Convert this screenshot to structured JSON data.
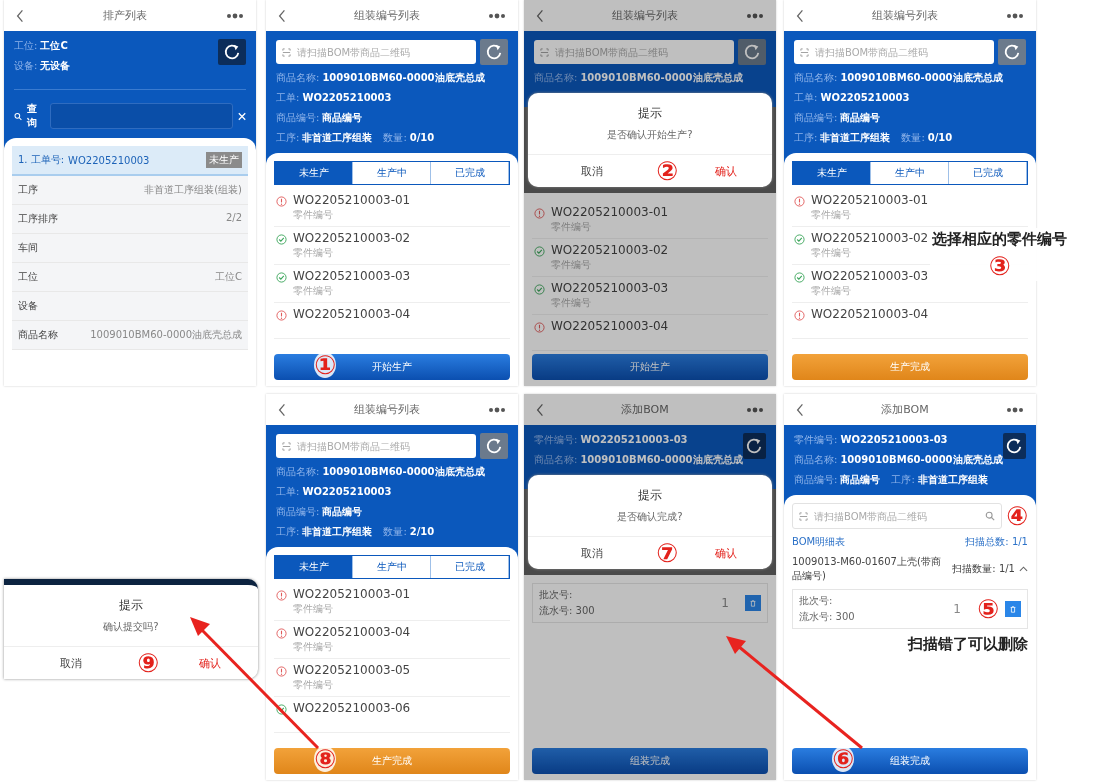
{
  "panels": [
    {
      "kind": "schedule",
      "title": "排产列表",
      "fields": [
        {
          "label": "工位:",
          "value": "工位C"
        },
        {
          "label": "设备:",
          "value": "无设备"
        }
      ],
      "search_label": "查询",
      "order": {
        "label": "1. 工单号:",
        "value": "WO2205210003",
        "badge": "未生产"
      },
      "rows": [
        {
          "label": "工序",
          "value": "非首道工序组装(组装)"
        },
        {
          "label": "工序排序",
          "value": "2/2"
        },
        {
          "label": "车间"
        },
        {
          "label": "工位",
          "value": "工位C"
        },
        {
          "label": "设备"
        },
        {
          "label": "商品名称",
          "value": "1009010BM60-0000油底壳总成"
        }
      ]
    },
    {
      "kind": "parts",
      "dimmed": false,
      "title": "组装编号列表",
      "placeholder": "请扫描BOM带商品二维码",
      "info": [
        {
          "label": "商品名称:",
          "value": "1009010BM60-0000油底壳总成"
        },
        {
          "label": "工单:",
          "value": "WO2205210003"
        },
        {
          "label": "商品编号:",
          "value": "商品编号"
        },
        {
          "label": "工序:",
          "value": "非首道工序组装",
          "label2": "数量:",
          "value2": "0/10"
        }
      ],
      "tabs": [
        {
          "label": "未生产",
          "selected": true
        },
        {
          "label": "生产中",
          "selected": false
        },
        {
          "label": "已完成",
          "selected": false
        }
      ],
      "items": [
        {
          "code": "WO2205210003-01",
          "sub": "零件编号",
          "done": false
        },
        {
          "code": "WO2205210003-02",
          "sub": "零件编号",
          "done": true
        },
        {
          "code": "WO2205210003-03",
          "sub": "零件编号",
          "done": true
        },
        {
          "code": "WO2205210003-04",
          "done": false
        }
      ],
      "button": {
        "label": "开始生产",
        "kind": "primary",
        "marker": "①"
      }
    },
    {
      "kind": "parts",
      "dimmed": true,
      "title": "组装编号列表",
      "placeholder": "请扫描BOM带商品二维码",
      "info": [
        {
          "label": "商品名称:",
          "value": "1009010BM60-0000油底壳总成"
        }
      ],
      "dialog": {
        "title": "提示",
        "message": "是否确认开始生产?",
        "cancel": "取消",
        "confirm": "确认",
        "marker": "②"
      },
      "items": [
        {
          "code": "WO2205210003-01",
          "sub": "零件编号",
          "done": false
        },
        {
          "code": "WO2205210003-02",
          "sub": "零件编号",
          "done": true
        },
        {
          "code": "WO2205210003-03",
          "sub": "零件编号",
          "done": true
        },
        {
          "code": "WO2205210003-04",
          "done": false
        }
      ],
      "button": {
        "label": "开始生产",
        "kind": "primary"
      }
    },
    {
      "kind": "parts",
      "dimmed": false,
      "title": "组装编号列表",
      "placeholder": "请扫描BOM带商品二维码",
      "info": [
        {
          "label": "商品名称:",
          "value": "1009010BM60-0000油底壳总成"
        },
        {
          "label": "工单:",
          "value": "WO2205210003"
        },
        {
          "label": "商品编号:",
          "value": "商品编号"
        },
        {
          "label": "工序:",
          "value": "非首道工序组装",
          "label2": "数量:",
          "value2": "0/10"
        }
      ],
      "tabs": [
        {
          "label": "未生产",
          "selected": true
        },
        {
          "label": "生产中",
          "selected": false
        },
        {
          "label": "已完成",
          "selected": false
        }
      ],
      "items": [
        {
          "code": "WO2205210003-01",
          "sub": "零件编号",
          "done": false
        },
        {
          "code": "WO2205210003-02",
          "sub": "零件编号",
          "done": true
        },
        {
          "code": "WO2205210003-03",
          "sub": "零件编号",
          "done": true
        },
        {
          "code": "WO2205210003-04",
          "done": false
        }
      ],
      "button": {
        "label": "生产完成",
        "kind": "warning"
      },
      "annotation": {
        "text": "选择相应的零件编号",
        "marker": "③"
      }
    },
    {
      "kind": "dialog_only",
      "dialog": {
        "title": "提示",
        "message": "确认提交吗?",
        "cancel": "取消",
        "confirm": "确认",
        "marker": "⑨"
      }
    },
    {
      "kind": "parts",
      "dimmed": false,
      "title": "组装编号列表",
      "placeholder": "请扫描BOM带商品二维码",
      "info": [
        {
          "label": "商品名称:",
          "value": "1009010BM60-0000油底壳总成"
        },
        {
          "label": "工单:",
          "value": "WO2205210003"
        },
        {
          "label": "商品编号:",
          "value": "商品编号"
        },
        {
          "label": "工序:",
          "value": "非首道工序组装",
          "label2": "数量:",
          "value2": "2/10"
        }
      ],
      "tabs": [
        {
          "label": "未生产",
          "selected": true
        },
        {
          "label": "生产中",
          "selected": false
        },
        {
          "label": "已完成",
          "selected": false
        }
      ],
      "items": [
        {
          "code": "WO2205210003-01",
          "sub": "零件编号",
          "done": false
        },
        {
          "code": "WO2205210003-04",
          "sub": "零件编号",
          "done": false
        },
        {
          "code": "WO2205210003-05",
          "sub": "零件编号",
          "done": false
        },
        {
          "code": "WO2205210003-06",
          "done": true
        }
      ],
      "button": {
        "label": "生产完成",
        "kind": "warning",
        "marker": "⑧"
      }
    },
    {
      "kind": "bom",
      "dimmed": true,
      "title": "添加BOM",
      "fields": [
        {
          "label": "零件编号:",
          "value": "WO2205210003-03"
        },
        {
          "label": "商品名称:",
          "value": "1009010BM60-0000油底壳总成"
        }
      ],
      "dialog": {
        "title": "提示",
        "message": "是否确认完成?",
        "cancel": "取消",
        "confirm": "确认",
        "marker": "⑦"
      },
      "batch": {
        "lines": [
          "批次号:",
          "流水号: 300"
        ],
        "qty": "1"
      },
      "button": {
        "label": "组装完成",
        "kind": "primary"
      }
    },
    {
      "kind": "bom",
      "dimmed": false,
      "title": "添加BOM",
      "fields": [
        {
          "label": "零件编号:",
          "value": "WO2205210003-03"
        },
        {
          "label": "商品名称:",
          "value": "1009010BM60-0000油底壳总成"
        },
        {
          "label": "商品编号:",
          "value": "商品编号",
          "label2": "工序:",
          "value2": "非首道工序组装"
        }
      ],
      "search": {
        "placeholder": "请扫描BOM带商品二维码",
        "marker": "④"
      },
      "detail": {
        "title": "BOM明细表",
        "total": "扫描总数: 1/1",
        "part": "1009013-M60-01607上壳(带商品编号)",
        "count": "扫描数量: 1/1",
        "expanded": true
      },
      "batch": {
        "lines": [
          "批次号:",
          "流水号: 300"
        ],
        "qty": "1",
        "marker": "⑤",
        "annotation": "扫描错了可以删除"
      },
      "button": {
        "label": "组装完成",
        "kind": "primary",
        "marker": "⑥"
      }
    }
  ]
}
